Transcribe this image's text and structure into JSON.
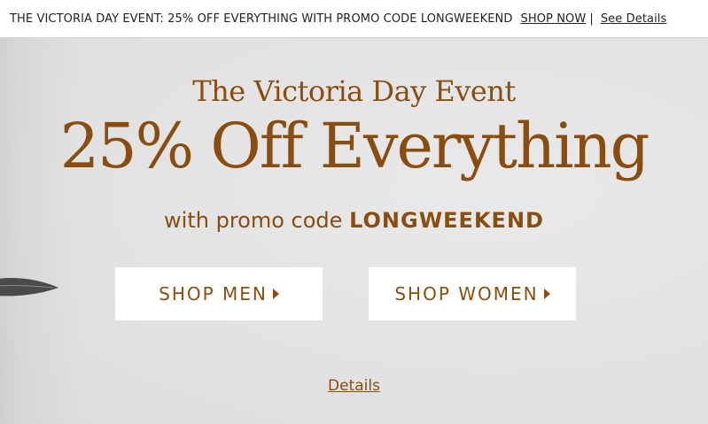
{
  "topbar": {
    "message": "THE VICTORIA DAY EVENT: 25% OFF EVERYTHING WITH PROMO CODE LONGWEEKEND",
    "shop_now": "SHOP NOW",
    "separator": "|",
    "see_details": "See Details"
  },
  "hero": {
    "heading": "The Victoria Day Event",
    "headline": "25% Off Everything",
    "promo_prefix": "with promo code",
    "promo_code": "LONGWEEKEND",
    "buttons": [
      {
        "label": "SHOP MEN",
        "icon": "caret-right-icon"
      },
      {
        "label": "SHOP WOMEN",
        "icon": "caret-right-icon"
      }
    ],
    "details_link": "Details"
  },
  "colors": {
    "accent": "#8a4d10",
    "background": "#e4e4e4",
    "button_bg": "#ffffff"
  }
}
